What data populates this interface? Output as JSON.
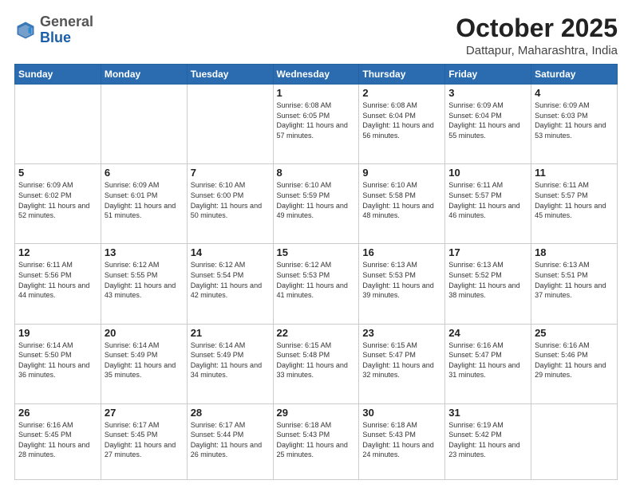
{
  "header": {
    "logo_general": "General",
    "logo_blue": "Blue",
    "month": "October 2025",
    "location": "Dattapur, Maharashtra, India"
  },
  "weekdays": [
    "Sunday",
    "Monday",
    "Tuesday",
    "Wednesday",
    "Thursday",
    "Friday",
    "Saturday"
  ],
  "weeks": [
    [
      {
        "day": "",
        "info": ""
      },
      {
        "day": "",
        "info": ""
      },
      {
        "day": "",
        "info": ""
      },
      {
        "day": "1",
        "info": "Sunrise: 6:08 AM\nSunset: 6:05 PM\nDaylight: 11 hours\nand 57 minutes."
      },
      {
        "day": "2",
        "info": "Sunrise: 6:08 AM\nSunset: 6:04 PM\nDaylight: 11 hours\nand 56 minutes."
      },
      {
        "day": "3",
        "info": "Sunrise: 6:09 AM\nSunset: 6:04 PM\nDaylight: 11 hours\nand 55 minutes."
      },
      {
        "day": "4",
        "info": "Sunrise: 6:09 AM\nSunset: 6:03 PM\nDaylight: 11 hours\nand 53 minutes."
      }
    ],
    [
      {
        "day": "5",
        "info": "Sunrise: 6:09 AM\nSunset: 6:02 PM\nDaylight: 11 hours\nand 52 minutes."
      },
      {
        "day": "6",
        "info": "Sunrise: 6:09 AM\nSunset: 6:01 PM\nDaylight: 11 hours\nand 51 minutes."
      },
      {
        "day": "7",
        "info": "Sunrise: 6:10 AM\nSunset: 6:00 PM\nDaylight: 11 hours\nand 50 minutes."
      },
      {
        "day": "8",
        "info": "Sunrise: 6:10 AM\nSunset: 5:59 PM\nDaylight: 11 hours\nand 49 minutes."
      },
      {
        "day": "9",
        "info": "Sunrise: 6:10 AM\nSunset: 5:58 PM\nDaylight: 11 hours\nand 48 minutes."
      },
      {
        "day": "10",
        "info": "Sunrise: 6:11 AM\nSunset: 5:57 PM\nDaylight: 11 hours\nand 46 minutes."
      },
      {
        "day": "11",
        "info": "Sunrise: 6:11 AM\nSunset: 5:57 PM\nDaylight: 11 hours\nand 45 minutes."
      }
    ],
    [
      {
        "day": "12",
        "info": "Sunrise: 6:11 AM\nSunset: 5:56 PM\nDaylight: 11 hours\nand 44 minutes."
      },
      {
        "day": "13",
        "info": "Sunrise: 6:12 AM\nSunset: 5:55 PM\nDaylight: 11 hours\nand 43 minutes."
      },
      {
        "day": "14",
        "info": "Sunrise: 6:12 AM\nSunset: 5:54 PM\nDaylight: 11 hours\nand 42 minutes."
      },
      {
        "day": "15",
        "info": "Sunrise: 6:12 AM\nSunset: 5:53 PM\nDaylight: 11 hours\nand 41 minutes."
      },
      {
        "day": "16",
        "info": "Sunrise: 6:13 AM\nSunset: 5:53 PM\nDaylight: 11 hours\nand 39 minutes."
      },
      {
        "day": "17",
        "info": "Sunrise: 6:13 AM\nSunset: 5:52 PM\nDaylight: 11 hours\nand 38 minutes."
      },
      {
        "day": "18",
        "info": "Sunrise: 6:13 AM\nSunset: 5:51 PM\nDaylight: 11 hours\nand 37 minutes."
      }
    ],
    [
      {
        "day": "19",
        "info": "Sunrise: 6:14 AM\nSunset: 5:50 PM\nDaylight: 11 hours\nand 36 minutes."
      },
      {
        "day": "20",
        "info": "Sunrise: 6:14 AM\nSunset: 5:49 PM\nDaylight: 11 hours\nand 35 minutes."
      },
      {
        "day": "21",
        "info": "Sunrise: 6:14 AM\nSunset: 5:49 PM\nDaylight: 11 hours\nand 34 minutes."
      },
      {
        "day": "22",
        "info": "Sunrise: 6:15 AM\nSunset: 5:48 PM\nDaylight: 11 hours\nand 33 minutes."
      },
      {
        "day": "23",
        "info": "Sunrise: 6:15 AM\nSunset: 5:47 PM\nDaylight: 11 hours\nand 32 minutes."
      },
      {
        "day": "24",
        "info": "Sunrise: 6:16 AM\nSunset: 5:47 PM\nDaylight: 11 hours\nand 31 minutes."
      },
      {
        "day": "25",
        "info": "Sunrise: 6:16 AM\nSunset: 5:46 PM\nDaylight: 11 hours\nand 29 minutes."
      }
    ],
    [
      {
        "day": "26",
        "info": "Sunrise: 6:16 AM\nSunset: 5:45 PM\nDaylight: 11 hours\nand 28 minutes."
      },
      {
        "day": "27",
        "info": "Sunrise: 6:17 AM\nSunset: 5:45 PM\nDaylight: 11 hours\nand 27 minutes."
      },
      {
        "day": "28",
        "info": "Sunrise: 6:17 AM\nSunset: 5:44 PM\nDaylight: 11 hours\nand 26 minutes."
      },
      {
        "day": "29",
        "info": "Sunrise: 6:18 AM\nSunset: 5:43 PM\nDaylight: 11 hours\nand 25 minutes."
      },
      {
        "day": "30",
        "info": "Sunrise: 6:18 AM\nSunset: 5:43 PM\nDaylight: 11 hours\nand 24 minutes."
      },
      {
        "day": "31",
        "info": "Sunrise: 6:19 AM\nSunset: 5:42 PM\nDaylight: 11 hours\nand 23 minutes."
      },
      {
        "day": "",
        "info": ""
      }
    ]
  ]
}
